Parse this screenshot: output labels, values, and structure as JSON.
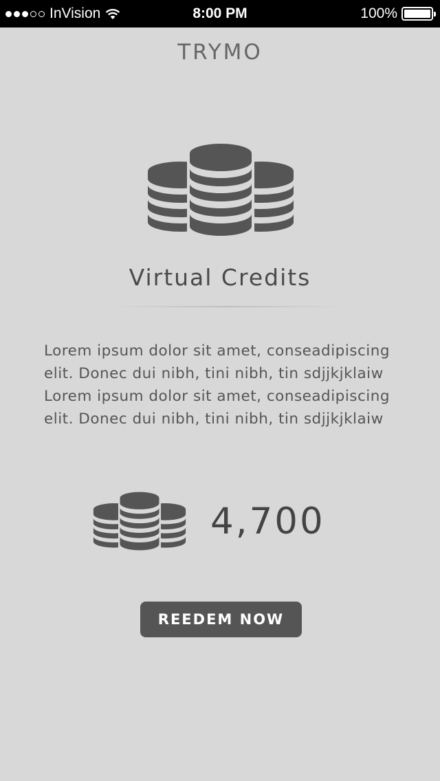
{
  "status_bar": {
    "carrier": "InVision",
    "time": "8:00 PM",
    "battery_percent": "100%",
    "battery_level": 1.0,
    "signal_bars_filled": 3,
    "signal_bars_total": 5
  },
  "header": {
    "title": "TRYMO"
  },
  "main": {
    "title": "Virtual Credits",
    "description_lines": [
      "Lorem ipsum dolor sit amet, conseadipiscing",
      "elit. Donec dui nibh, tini nibh, tin sdjjkjklaiw",
      "Lorem ipsum dolor sit amet, conseadipiscing",
      "elit. Donec dui nibh, tini nibh, tin sdjjkjklaiw"
    ],
    "credits_value": "4,700",
    "redeem_label": "REEDEM NOW"
  },
  "icons": {
    "hero": "coin-stacks-icon",
    "credit": "coin-stacks-icon",
    "wifi": "wifi-icon",
    "battery": "battery-icon"
  },
  "colors": {
    "background": "#d8d8d8",
    "icon": "#555555",
    "button": "#555555",
    "status_bar": "#000000"
  }
}
